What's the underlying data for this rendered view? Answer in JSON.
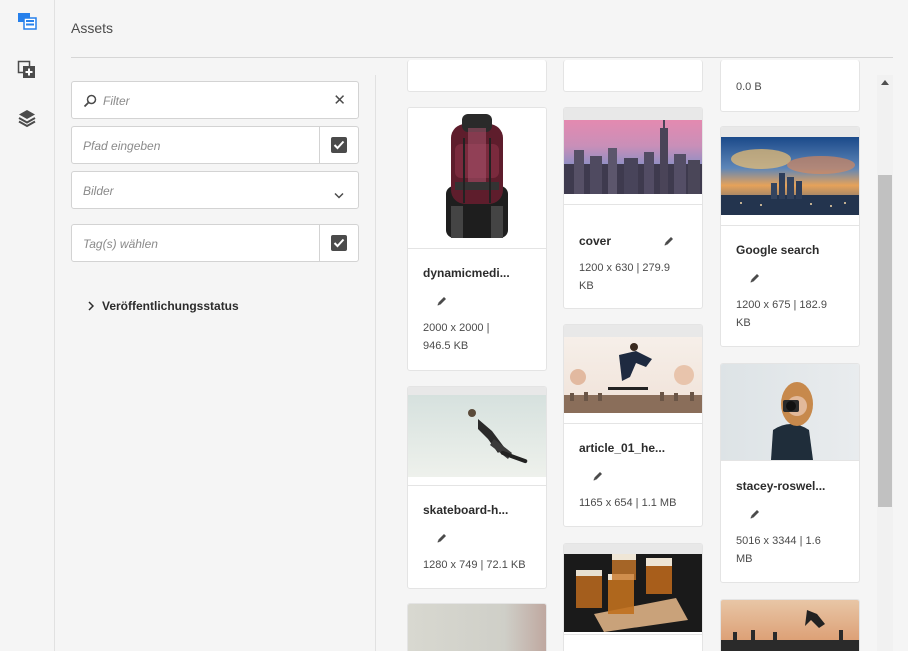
{
  "panel": {
    "title": "Assets"
  },
  "rail": {
    "items": [
      {
        "name": "assets-icon",
        "active": true
      },
      {
        "name": "components-icon",
        "active": false
      },
      {
        "name": "layers-icon",
        "active": false
      }
    ]
  },
  "filters": {
    "search_placeholder": "Filter",
    "path_placeholder": "Pfad eingeben",
    "type_select_value": "Bilder",
    "tags_placeholder": "Tag(s) wählen",
    "publication_status_label": "Veröffentlichungsstatus"
  },
  "assets": [
    {
      "id": "top1",
      "meta_line1": ""
    },
    {
      "id": "top2",
      "meta_line1": ""
    },
    {
      "id": "top3",
      "meta_line1": "0.0 B"
    },
    {
      "id": "c1",
      "name": "dynamicmedi...",
      "meta_line1": "2000 x 2000 |",
      "meta_line2": "946.5 KB"
    },
    {
      "id": "c2",
      "name": "skateboard-h...",
      "meta_line1": "1280 x 749 | 72.1 KB"
    },
    {
      "id": "c3",
      "name": "cover",
      "meta_line1": "1200 x 630 | 279.9",
      "meta_line2": "KB"
    },
    {
      "id": "c4",
      "name": "article_01_he...",
      "meta_line1": "1165 x 654 | 1.1 MB"
    },
    {
      "id": "c5",
      "name": "Google search",
      "meta_line1": "1200 x 675 | 182.9",
      "meta_line2": "KB"
    },
    {
      "id": "c6",
      "name": "stacey-roswel...",
      "meta_line1": "5016 x 3344 | 1.6",
      "meta_line2": "MB"
    }
  ],
  "colors": {
    "accent": "#2680eb",
    "icon": "#4b4b4b",
    "border": "#d3d3d3"
  }
}
